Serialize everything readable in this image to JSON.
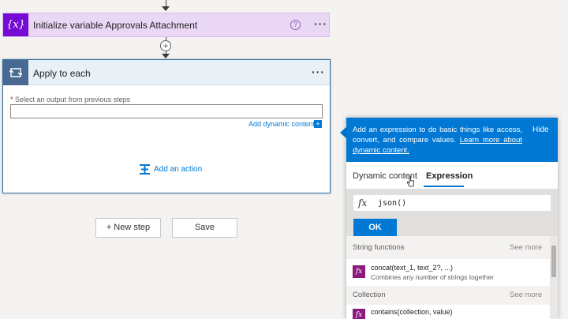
{
  "flow": {
    "variable_step": {
      "title": "Initialize variable Approvals Attachment",
      "icon": "{x}",
      "help": "?",
      "menu": "···"
    },
    "insert_plus": "+",
    "apply_step": {
      "title": "Apply to each",
      "menu": "···",
      "field_required": "*",
      "field_label": "Select an output from previous steps",
      "field_value": "",
      "dynamic_link": "Add dynamic content",
      "dynamic_plus": "+",
      "add_action": "Add an action"
    },
    "new_step": "+ New step",
    "save": "Save"
  },
  "panel": {
    "description_prefix": "Add an expression to do basic things like access, convert, and compare values.",
    "learn_more": "Learn more about dynamic content.",
    "hide": "Hide",
    "tabs": [
      "Dynamic content",
      "Expression"
    ],
    "active_tab": "Expression",
    "fx_symbol": "fx",
    "expression_value": "json()",
    "ok": "OK",
    "sections": [
      {
        "name": "String functions",
        "see_more": "See more",
        "items": [
          {
            "name": "concat(text_1, text_2?, ...)",
            "description": "Combines any number of strings together"
          }
        ]
      },
      {
        "name": "Collection",
        "see_more": "See more",
        "items": [
          {
            "name": "contains(collection, value)",
            "description": ""
          }
        ]
      }
    ]
  },
  "colors": {
    "variable_accent": "#770bd6",
    "variable_bg": "#ead7f5",
    "apply_accent": "#486991",
    "primary_blue": "#0078d4",
    "function_icon": "#8b1a7e"
  },
  "icons": [
    "variable-icon",
    "help-icon",
    "more-icon",
    "loop-icon",
    "add-action-icon",
    "fx-icon",
    "cursor-icon",
    "function-icon",
    "arrow-down-icon",
    "plus-icon"
  ]
}
